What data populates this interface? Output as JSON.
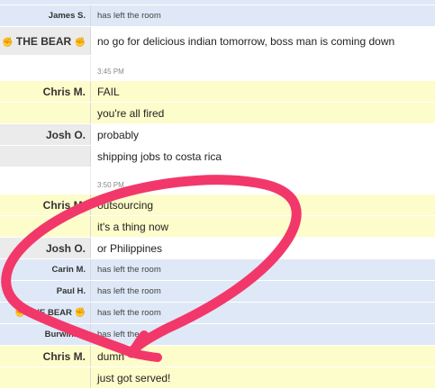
{
  "chat": {
    "rows": [
      {
        "name": "James S.",
        "message": "has left the room"
      },
      {
        "name": "THE BEAR",
        "message": "no go for delicious indian tomorrow, boss man is coming down"
      },
      {
        "timestamp": "3:45 PM"
      },
      {
        "name": "Chris M.",
        "message": "FAIL"
      },
      {
        "message": "you're all fired"
      },
      {
        "name": "Josh O.",
        "message": "probably"
      },
      {
        "message": "shipping jobs to costa rica"
      },
      {
        "timestamp": "3:50 PM"
      },
      {
        "name": "Chris M.",
        "message": "outsourcing"
      },
      {
        "message": "it's a thing now"
      },
      {
        "name": "Josh O.",
        "message": "or Philippines"
      },
      {
        "name": "Carin M.",
        "message": "has left the room"
      },
      {
        "name": "Paul H.",
        "message": "has left the room"
      },
      {
        "name": "THE BEAR",
        "message": "has left the room"
      },
      {
        "name": "Burwinkel",
        "message": "has left the room"
      },
      {
        "name": "Chris M.",
        "message": "dumn"
      },
      {
        "message": "just got served!"
      }
    ]
  },
  "colors": {
    "system_row": "#dfe8f6",
    "highlight_row": "#fdfccb",
    "scribble": "#f2386a"
  },
  "icons": {
    "bear_badge": "fist-icon"
  }
}
